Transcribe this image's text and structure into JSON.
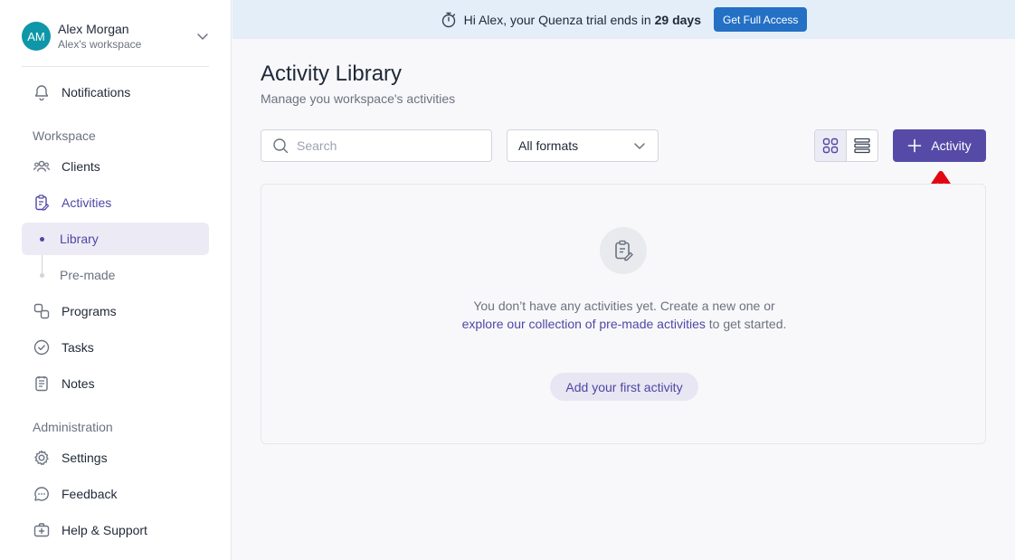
{
  "user": {
    "initials": "AM",
    "name": "Alex Morgan",
    "workspace": "Alex's workspace"
  },
  "nav": {
    "notifications": "Notifications",
    "workspace_label": "Workspace",
    "clients": "Clients",
    "activities": "Activities",
    "library": "Library",
    "premade": "Pre-made",
    "programs": "Programs",
    "tasks": "Tasks",
    "notes": "Notes",
    "administration_label": "Administration",
    "settings": "Settings",
    "feedback": "Feedback",
    "help": "Help & Support"
  },
  "banner": {
    "text": "Hi Alex, your Quenza trial ends in",
    "days": "29 days",
    "button": "Get Full Access"
  },
  "page": {
    "title": "Activity Library",
    "subtitle": "Manage you workspace's activities"
  },
  "toolbar": {
    "search_placeholder": "Search",
    "format_selected": "All formats",
    "add_button": "Activity"
  },
  "empty": {
    "text_1": "You don’t have any activities yet. Create a new one or",
    "link": "explore our collection of pre-made activities",
    "text_2": "to get started.",
    "button": "Add your first activity"
  },
  "colors": {
    "accent": "#554ba7",
    "banner_bg": "#e4eef9",
    "banner_button": "#2370c5",
    "avatar": "#0d97a8",
    "annotation_arrow": "#e30613"
  }
}
